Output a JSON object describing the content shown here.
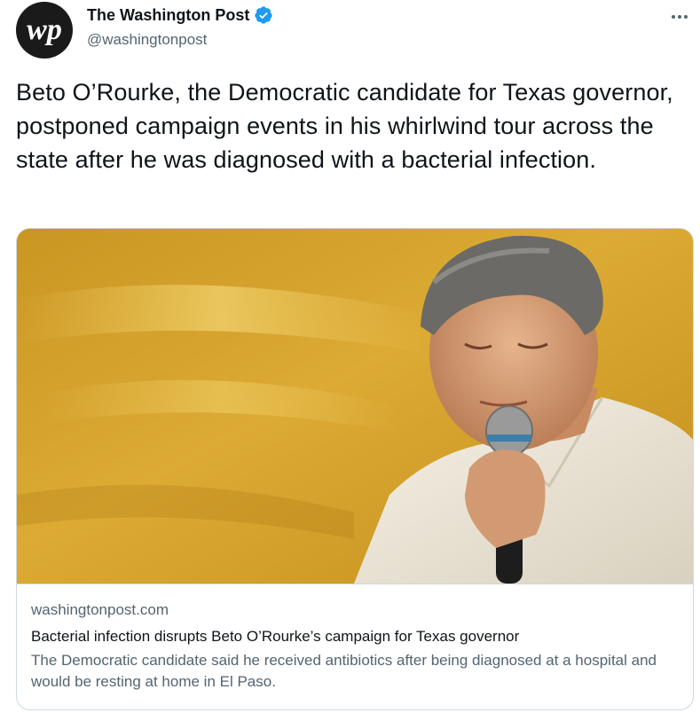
{
  "author": {
    "display_name": "The Washington Post",
    "handle": "@washingtonpost",
    "avatar_monogram": "wp",
    "verified": true,
    "verified_icon": "verified-badge-icon"
  },
  "menu": {
    "icon": "more-horizontal-icon"
  },
  "tweet": {
    "text": "Beto O’Rourke, the Democratic candidate for Texas governor, postponed campaign events in his whirlwind tour across the state after he was diagnosed with a bacterial infection."
  },
  "card": {
    "domain": "washingtonpost.com",
    "title": "Bacterial infection disrupts Beto O’Rourke’s campaign for Texas governor",
    "description": "The Democratic candidate said he received antibiotics after being diagnosed at a hospital and would be resting at home in El Paso."
  },
  "colors": {
    "text_primary": "#0f1419",
    "text_secondary": "#536471",
    "verified_blue": "#1d9bf0",
    "border": "#cfd9de",
    "image_background": "#d9a52c"
  }
}
